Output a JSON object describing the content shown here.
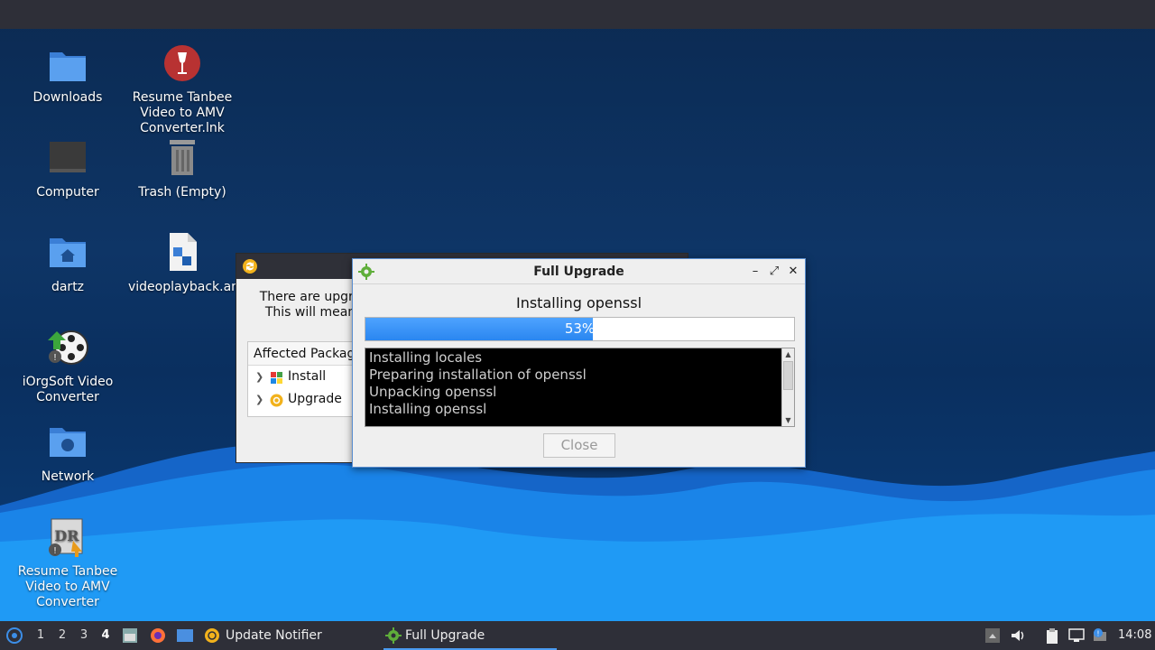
{
  "desktop": {
    "icons": [
      {
        "label": "Downloads",
        "icon": "folder-download-icon"
      },
      {
        "label": "Resume Tanbee Video to AMV Converter.lnk",
        "icon": "wine-glass-icon"
      },
      {
        "label": "Computer",
        "icon": "monitor-icon"
      },
      {
        "label": "Trash (Empty)",
        "icon": "trash-icon"
      },
      {
        "label": "dartz",
        "icon": "home-folder-icon"
      },
      {
        "label": "videoplayback.amv",
        "icon": "file-icon"
      },
      {
        "label": "iOrgSoft Video Converter",
        "icon": "film-reel-icon"
      },
      {
        "label": "Network",
        "icon": "network-folder-icon"
      },
      {
        "label": "Resume Tanbee Video to AMV Converter",
        "icon": "dvd-converter-icon"
      }
    ]
  },
  "notifier_window": {
    "message_line1": "There are upgra",
    "message_line2": "This will mean",
    "affected_header": "Affected Packag",
    "tree": [
      {
        "label": "Install",
        "icon": "install-icon"
      },
      {
        "label": "Upgrade",
        "icon": "upgrade-icon"
      }
    ]
  },
  "upgrade_dialog": {
    "title": "Full Upgrade",
    "status": "Installing openssl",
    "progress_percent": 53,
    "progress_label": "53%",
    "log": [
      "Installing locales",
      "Preparing installation of openssl",
      "Unpacking openssl",
      "Installing openssl"
    ],
    "close_label": "Close",
    "minimize_glyph": "–",
    "maximize_glyph": "⤢",
    "close_glyph": "✕"
  },
  "taskbar": {
    "workspaces": [
      "1",
      "2",
      "3",
      "4"
    ],
    "active_workspace": "4",
    "tasks": [
      {
        "label": "Update Notifier",
        "icon": "update-notifier-icon"
      },
      {
        "label": "Full Upgrade",
        "icon": "gear-icon"
      }
    ],
    "clock": "14:08"
  },
  "colors": {
    "accent": "#2a86f0",
    "panel": "#2e2f38",
    "desktop": "#0e3566"
  }
}
